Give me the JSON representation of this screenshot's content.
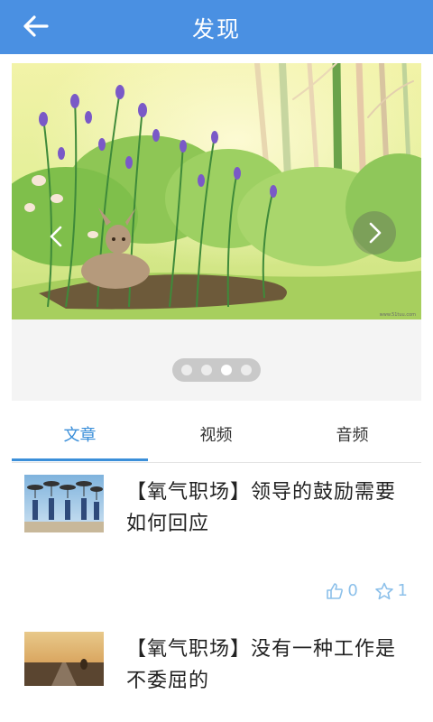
{
  "header": {
    "title": "发现",
    "back_icon": "arrow-left-icon"
  },
  "banner": {
    "prev_icon": "chevron-left-icon",
    "next_icon": "chevron-right-icon",
    "slide_count": 4,
    "active_slide": 3,
    "watermark": "www.51tuu.com"
  },
  "tabs": [
    {
      "label": "文章",
      "active": true
    },
    {
      "label": "视频",
      "active": false
    },
    {
      "label": "音频",
      "active": false
    }
  ],
  "articles": [
    {
      "title": "【氧气职场】领导的鼓励需要如何回应",
      "likes": "0",
      "favorites": "1"
    },
    {
      "title": "【氧气职场】没有一种工作是不委屈的"
    }
  ],
  "colors": {
    "primary": "#4a90e2",
    "tab_active": "#3b8fd9",
    "stat": "#8cc0ea"
  }
}
